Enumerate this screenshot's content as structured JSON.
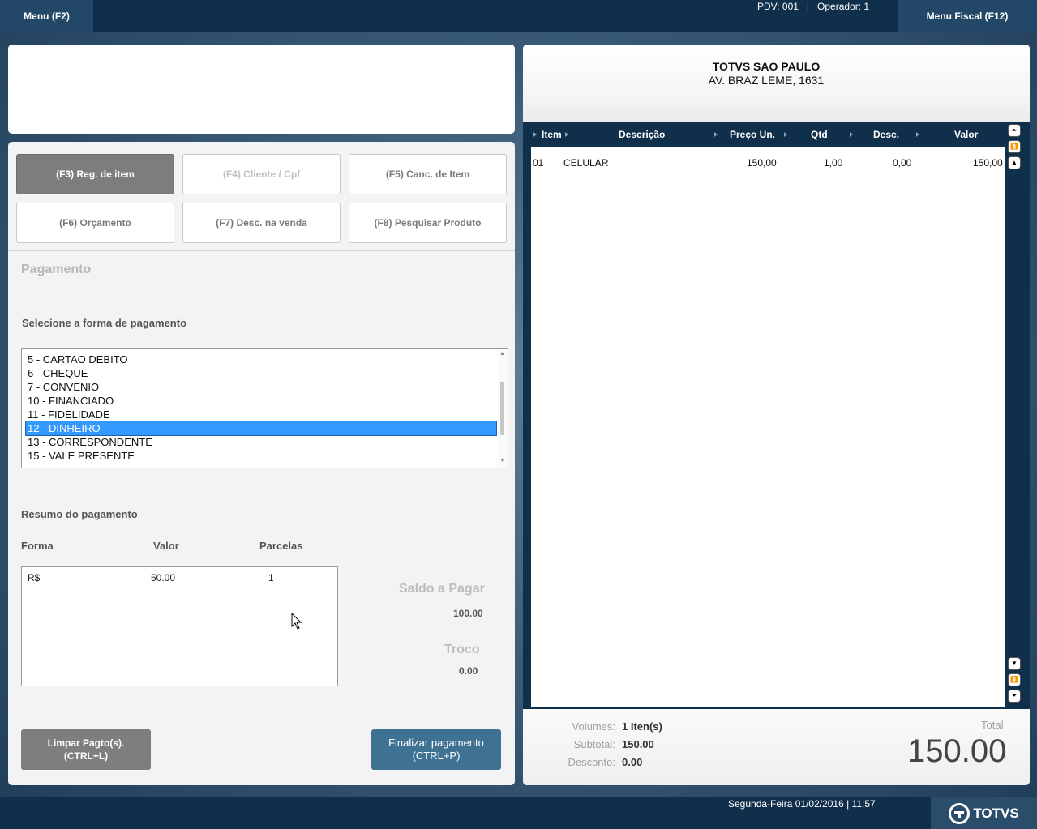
{
  "topbar": {
    "menu_label": "Menu (F2)",
    "pdv": "PDV: 001",
    "separator": "|",
    "operador": "Operador: 1",
    "fiscal_label": "Menu Fiscal (F12)"
  },
  "functions": {
    "f3": "(F3) Reg. de item",
    "f4": "(F4) Cliente / Cpf",
    "f5": "(F5) Canc. de Item",
    "f6": "(F6) Orçamento",
    "f7": "(F7) Desc. na venda",
    "f8": "(F8) Pesquisar Produto"
  },
  "payment": {
    "title": "Pagamento",
    "select_label": "Selecione a forma de pagamento",
    "options": [
      "5 - CARTAO DEBITO",
      "6 - CHEQUE",
      "7 - CONVENIO",
      "10 - FINANCIADO",
      "11 - FIDELIDADE",
      "12 - DINHEIRO",
      "13 - CORRESPONDENTE",
      "15 - VALE PRESENTE"
    ],
    "selected": "12 - DINHEIRO"
  },
  "resumo": {
    "title": "Resumo do pagamento",
    "col_forma": "Forma",
    "col_valor": "Valor",
    "col_parcelas": "Parcelas",
    "row_forma": "R$",
    "row_valor": "50.00",
    "row_parcelas": "1"
  },
  "saldo": {
    "label": "Saldo a Pagar",
    "value": "100.00"
  },
  "troco": {
    "label": "Troco",
    "value": "0.00"
  },
  "actions": {
    "limpar_line1": "Limpar Pagto(s).",
    "limpar_line2": "(CTRL+L)",
    "finalizar_line1": "Finalizar pagamento",
    "finalizar_line2": "(CTRL+P)"
  },
  "receipt": {
    "store_name": "TOTVS SAO PAULO",
    "store_address": "AV. BRAZ LEME, 1631",
    "columns": {
      "item": "Item",
      "descricao": "Descrição",
      "preco": "Preço Un.",
      "qtd": "Qtd",
      "desc": "Desc.",
      "valor": "Valor"
    },
    "rows": [
      {
        "item": "01",
        "descricao": "CELULAR",
        "preco": "150,00",
        "qtd": "1,00",
        "desc": "0,00",
        "valor": "150,00"
      }
    ]
  },
  "totals": {
    "volumes_label": "Volumes:",
    "volumes_value": "1 Iten(s)",
    "subtotal_label": "Subtotal:",
    "subtotal_value": "150.00",
    "desconto_label": "Desconto:",
    "desconto_value": "0.00",
    "total_label": "Total",
    "total_value": "150.00"
  },
  "footer": {
    "datetime": "Segunda-Feira 01/02/2016 | 11:57",
    "brand": "TOTVS"
  }
}
